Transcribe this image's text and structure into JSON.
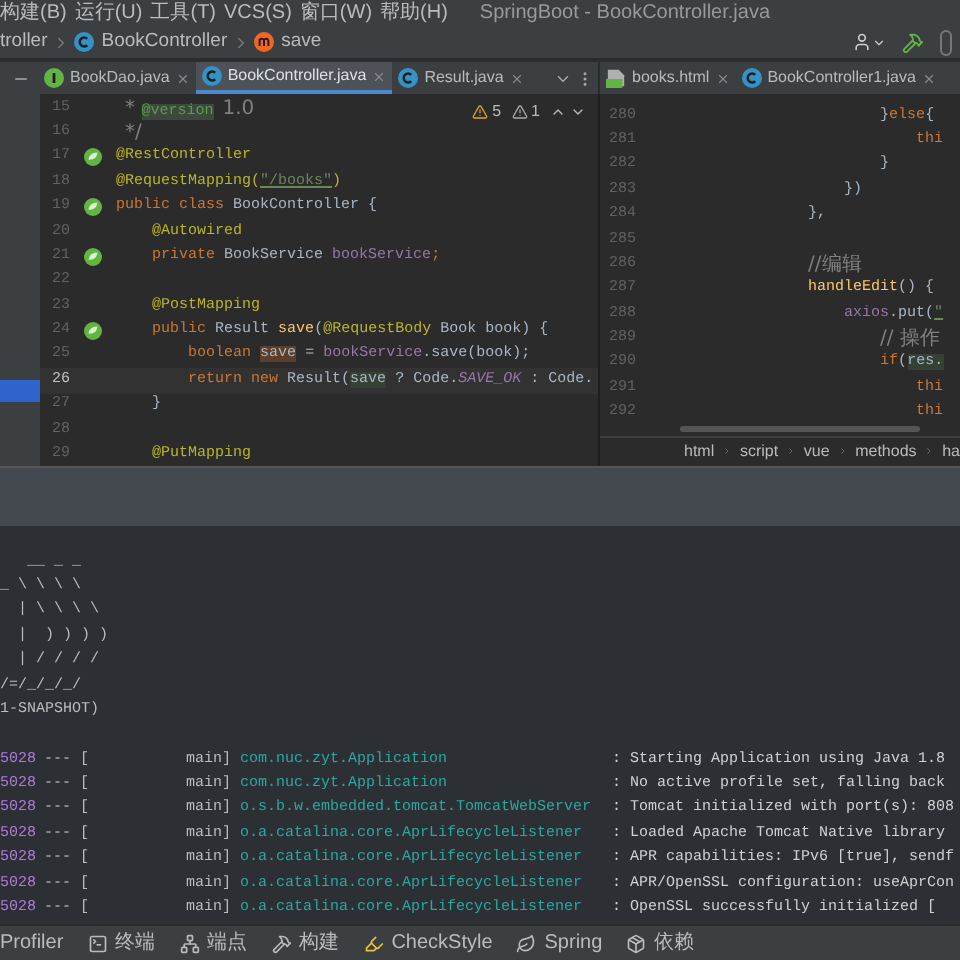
{
  "menu": [
    "构建(B)",
    "运行(U)",
    "工具(T)",
    "VCS(S)",
    "窗口(W)",
    "帮助(H)"
  ],
  "window_title": "SpringBoot - BookController.java",
  "breadcrumb": [
    {
      "label": "troller",
      "kind": "none"
    },
    {
      "label": "BookController",
      "kind": "class"
    },
    {
      "label": "save",
      "kind": "method"
    }
  ],
  "left_tabs": [
    {
      "label": "BookDao.java",
      "kind": "interface",
      "selected": false
    },
    {
      "label": "BookController.java",
      "kind": "class",
      "selected": true
    },
    {
      "label": "Result.java",
      "kind": "class",
      "selected": false
    }
  ],
  "right_tabs": [
    {
      "label": "books.html",
      "kind": "html",
      "selected": false
    },
    {
      "label": "BookController1.java",
      "kind": "class",
      "selected": false
    }
  ],
  "inspections": {
    "warnings": "5",
    "weak_warnings": "1"
  },
  "left_editor": {
    "lines": [
      {
        "n": "15",
        "current": false,
        "kind": "plain",
        "tokens": [
          {
            "text": " * ",
            "kind": "comment"
          },
          {
            "text": "@version",
            "kind": "doctag"
          },
          {
            "text": " 1.0",
            "kind": "comment"
          }
        ]
      },
      {
        "n": "16",
        "current": false,
        "kind": "plain",
        "tokens": [
          {
            "text": " */",
            "kind": "comment"
          }
        ]
      },
      {
        "n": "17",
        "current": false,
        "kind": "bean",
        "tokens": [
          {
            "text": "@RestController",
            "kind": "annotation"
          }
        ]
      },
      {
        "n": "18",
        "current": false,
        "kind": "plain",
        "tokens": [
          {
            "text": "@RequestMapping(",
            "kind": "annotation"
          },
          {
            "text": "\"/books\"",
            "kind": "string"
          },
          {
            "text": ")",
            "kind": "annotation"
          }
        ]
      },
      {
        "n": "19",
        "current": false,
        "kind": "bean",
        "tokens": [
          {
            "text": "public class ",
            "kind": "keyword"
          },
          {
            "text": "BookController {",
            "kind": "plain"
          }
        ]
      },
      {
        "n": "20",
        "current": false,
        "kind": "plain",
        "tokens": [
          {
            "text": "    @Autowired",
            "kind": "annotation"
          }
        ]
      },
      {
        "n": "21",
        "current": false,
        "kind": "bean",
        "tokens": [
          {
            "text": "    private ",
            "kind": "keyword"
          },
          {
            "text": "BookService ",
            "kind": "plain"
          },
          {
            "text": "bookService",
            "kind": "field"
          },
          {
            "text": ";",
            "kind": "keyword"
          }
        ]
      },
      {
        "n": "22",
        "current": false,
        "kind": "plain"
      },
      {
        "n": "23",
        "current": false,
        "kind": "plain",
        "tokens": [
          {
            "text": "    @PostMapping",
            "kind": "annotation"
          }
        ]
      },
      {
        "n": "24",
        "current": false,
        "kind": "bean",
        "tokens": [
          {
            "text": "    public ",
            "kind": "keyword"
          },
          {
            "text": "Result ",
            "kind": "plain"
          },
          {
            "text": "save",
            "kind": "method"
          },
          {
            "text": "(",
            "kind": "plain"
          },
          {
            "text": "@RequestBody ",
            "kind": "annotation"
          },
          {
            "text": "Book book) {",
            "kind": "plain"
          }
        ]
      },
      {
        "n": "25",
        "current": false,
        "kind": "plain",
        "tokens": [
          {
            "text": "        boolean ",
            "kind": "keyword"
          },
          {
            "text": "save",
            "kind": "write"
          },
          {
            "text": " = ",
            "kind": "plain"
          },
          {
            "text": "bookService",
            "kind": "field"
          },
          {
            "text": ".save(book);",
            "kind": "plain"
          }
        ]
      },
      {
        "n": "26",
        "current": true,
        "kind": "plain",
        "tokens": [
          {
            "text": "        return new ",
            "kind": "keyword"
          },
          {
            "text": "Result(",
            "kind": "plain"
          },
          {
            "text": "save",
            "kind": "read"
          },
          {
            "text": " ? Code.",
            "kind": "plain"
          },
          {
            "text": "SAVE_OK",
            "kind": "constant"
          },
          {
            "text": " : Code.",
            "kind": "plain"
          }
        ]
      },
      {
        "n": "27",
        "current": false,
        "kind": "plain",
        "tokens": [
          {
            "text": "    }",
            "kind": "plain"
          }
        ]
      },
      {
        "n": "28",
        "current": false,
        "kind": "plain"
      },
      {
        "n": "29",
        "current": false,
        "kind": "plain",
        "tokens": [
          {
            "text": "    @PutMapping",
            "kind": "annotation"
          }
        ]
      }
    ]
  },
  "right_editor": {
    "lines": [
      {
        "n": "280",
        "tokens": [
          {
            "text": "                        }",
            "kind": "plain"
          },
          {
            "text": "else",
            "kind": "keyword"
          },
          {
            "text": "{",
            "kind": "plain"
          }
        ]
      },
      {
        "n": "281",
        "tokens": [
          {
            "text": "                            thi",
            "kind": "keyword"
          }
        ]
      },
      {
        "n": "282",
        "tokens": [
          {
            "text": "                        }",
            "kind": "plain"
          }
        ]
      },
      {
        "n": "283",
        "tokens": [
          {
            "text": "                    })",
            "kind": "plain"
          }
        ]
      },
      {
        "n": "284",
        "tokens": [
          {
            "text": "                },",
            "kind": "plain"
          }
        ]
      },
      {
        "n": "285"
      },
      {
        "n": "286",
        "tokens": [
          {
            "text": "                //编辑",
            "kind": "comment"
          }
        ]
      },
      {
        "n": "287",
        "tokens": [
          {
            "text": "                handleEdit",
            "kind": "method"
          },
          {
            "text": "() {",
            "kind": "plain"
          }
        ]
      },
      {
        "n": "288",
        "tokens": [
          {
            "text": "                    axios",
            "kind": "field"
          },
          {
            "text": ".put(",
            "kind": "plain"
          },
          {
            "text": "\"",
            "kind": "string"
          }
        ]
      },
      {
        "n": "289",
        "tokens": [
          {
            "text": "                        // 操作",
            "kind": "comment"
          }
        ]
      },
      {
        "n": "290",
        "tokens": [
          {
            "text": "                        if",
            "kind": "keyword"
          },
          {
            "text": "(",
            "kind": "plain"
          },
          {
            "text": "res.",
            "kind": "read"
          }
        ]
      },
      {
        "n": "291",
        "tokens": [
          {
            "text": "                            thi",
            "kind": "keyword"
          }
        ]
      },
      {
        "n": "292",
        "tokens": [
          {
            "text": "                            thi",
            "kind": "keyword"
          }
        ]
      }
    ],
    "breadcrumb": [
      "html",
      "script",
      "vue",
      "methods",
      "ha"
    ]
  },
  "console": {
    "banner": [
      "   __ _ _",
      "_ \\ \\ \\ \\",
      "  | \\ \\ \\ \\",
      "  |  ) ) ) )",
      "  | / / / /",
      "/=/_/_/_/",
      "1-SNAPSHOT)"
    ],
    "logs": [
      {
        "pid": "5028",
        "sep": "--- [",
        "thread": "main]",
        "logger": "com.nuc.zyt.Application",
        "message": ": Starting Application using Java 1.8"
      },
      {
        "pid": "5028",
        "sep": "--- [",
        "thread": "main]",
        "logger": "com.nuc.zyt.Application",
        "message": ": No active profile set, falling back"
      },
      {
        "pid": "5028",
        "sep": "--- [",
        "thread": "main]",
        "logger": "o.s.b.w.embedded.tomcat.TomcatWebServer",
        "message": ": Tomcat initialized with port(s): 808"
      },
      {
        "pid": "5028",
        "sep": "--- [",
        "thread": "main]",
        "logger": "o.a.catalina.core.AprLifecycleListener",
        "message": ": Loaded Apache Tomcat Native library"
      },
      {
        "pid": "5028",
        "sep": "--- [",
        "thread": "main]",
        "logger": "o.a.catalina.core.AprLifecycleListener",
        "message": ": APR capabilities: IPv6 [true], sendf"
      },
      {
        "pid": "5028",
        "sep": "--- [",
        "thread": "main]",
        "logger": "o.a.catalina.core.AprLifecycleListener",
        "message": ": APR/OpenSSL configuration: useAprCon"
      },
      {
        "pid": "5028",
        "sep": "--- [",
        "thread": "main]",
        "logger": "o.a.catalina.core.AprLifecycleListener",
        "message": ": OpenSSL successfully initialized ["
      }
    ]
  },
  "tool_windows": [
    {
      "label": "Profiler",
      "kind": "none"
    },
    {
      "label": "终端",
      "kind": "terminal"
    },
    {
      "label": "端点",
      "kind": "endpoints"
    },
    {
      "label": "构建",
      "kind": "build"
    },
    {
      "label": "CheckStyle",
      "kind": "checkstyle"
    },
    {
      "label": "Spring",
      "kind": "spring"
    },
    {
      "label": "依赖",
      "kind": "dependencies"
    }
  ]
}
